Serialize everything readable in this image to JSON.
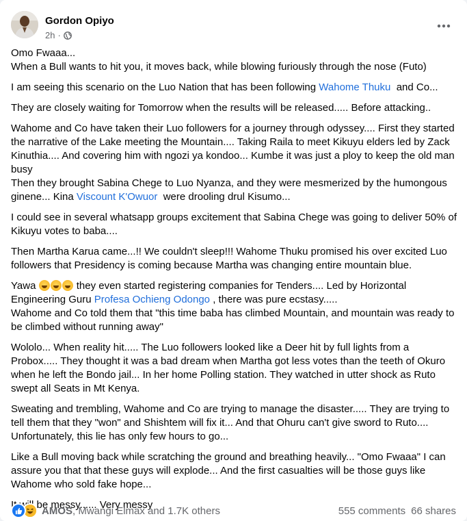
{
  "post": {
    "author": "Gordon Opiyo",
    "time": "2h",
    "separator": "·"
  },
  "icons": {
    "audience": "globe-icon",
    "menu": "more-options-icon",
    "reaction_1": "like-reaction-icon",
    "reaction_2": "haha-reaction-icon"
  },
  "colors": {
    "link": "#216fdb",
    "like": "#1877f2",
    "haha": "#f7b928",
    "muted": "#65676b"
  },
  "content": {
    "p1_line1": "Omo Fwaaa...",
    "p1_line2": "When a Bull wants to hit you, it moves back, while blowing furiously through the nose (Futo)",
    "p2_before": "I am seeing this scenario on the Luo Nation that has been following ",
    "p2_link": "Wahome Thuku",
    "p2_after": "  and Co...",
    "p3": "They are closely waiting for Tomorrow when the results will be released..... Before attacking..",
    "p4_part1": "Wahome and Co have taken their Luo followers for a journey through odyssey.... First they started the narrative of the Lake meeting the Mountain.... Taking Raila to meet Kikuyu elders led by Zack Kinuthia.... And covering him with ngozi ya kondoo... Kumbe it was just a ploy to keep the old man busy",
    "p4_part2": "Then they brought Sabina Chege to Luo Nyanza, and they were mesmerized by the humongous ginene... Kina ",
    "p4_link": "Viscount K'Owuor",
    "p4_after": "  were drooling drul Kisumo...",
    "p5": "I could see in several whatsapp groups excitement that Sabina Chege was going to deliver 50% of Kikuyu votes to baba....",
    "p6": "Then Martha Karua came...!! We couldn't sleep!!! Wahome Thuku promised his over excited Luo followers that Presidency is coming because Martha was changing entire mountain blue.",
    "p7_before": "Yawa ",
    "p7_emojis": "😅😅😅",
    "p7_mid": " they even started registering companies for Tenders.... Led by Horizontal Engineering Guru ",
    "p7_link": "Profesa Ochieng Odongo",
    "p7_after": " , there was pure ecstasy.....",
    "p7_line2": "Wahome and Co told them that \"this time baba has climbed Mountain, and mountain was ready to be climbed without running away\"",
    "p8": "Wololo... When reality hit..... The Luo followers looked like a Deer hit by full lights from a Probox..... They thought it was a bad dream when Martha got less votes than the teeth of Okuro when he left the Bondo jail... In her home Polling station. They watched in utter shock as Ruto swept all Seats in Mt Kenya.",
    "p9": "Sweating and trembling, Wahome and Co are trying to manage the disaster..... They are trying to tell them that they \"won\" and Shishtem will fix it... And that Ohuru can't give sword to Ruto.... Unfortunately, this lie has only few hours to go...",
    "p10": "Like a Bull moving back while scratching the ground and breathing heavily... \"Omo Fwaaa\" I can assure you that that these guys will explode... And the first casualties will be those guys like Wahome who sold fake hope...",
    "p11": "It will be messy...... Very messy"
  },
  "footer": {
    "reactor_bold": "AMOS",
    "reactor_rest": ", Mwangi Elmax and 1.7K others",
    "comments": "555 comments",
    "shares": "66 shares"
  }
}
